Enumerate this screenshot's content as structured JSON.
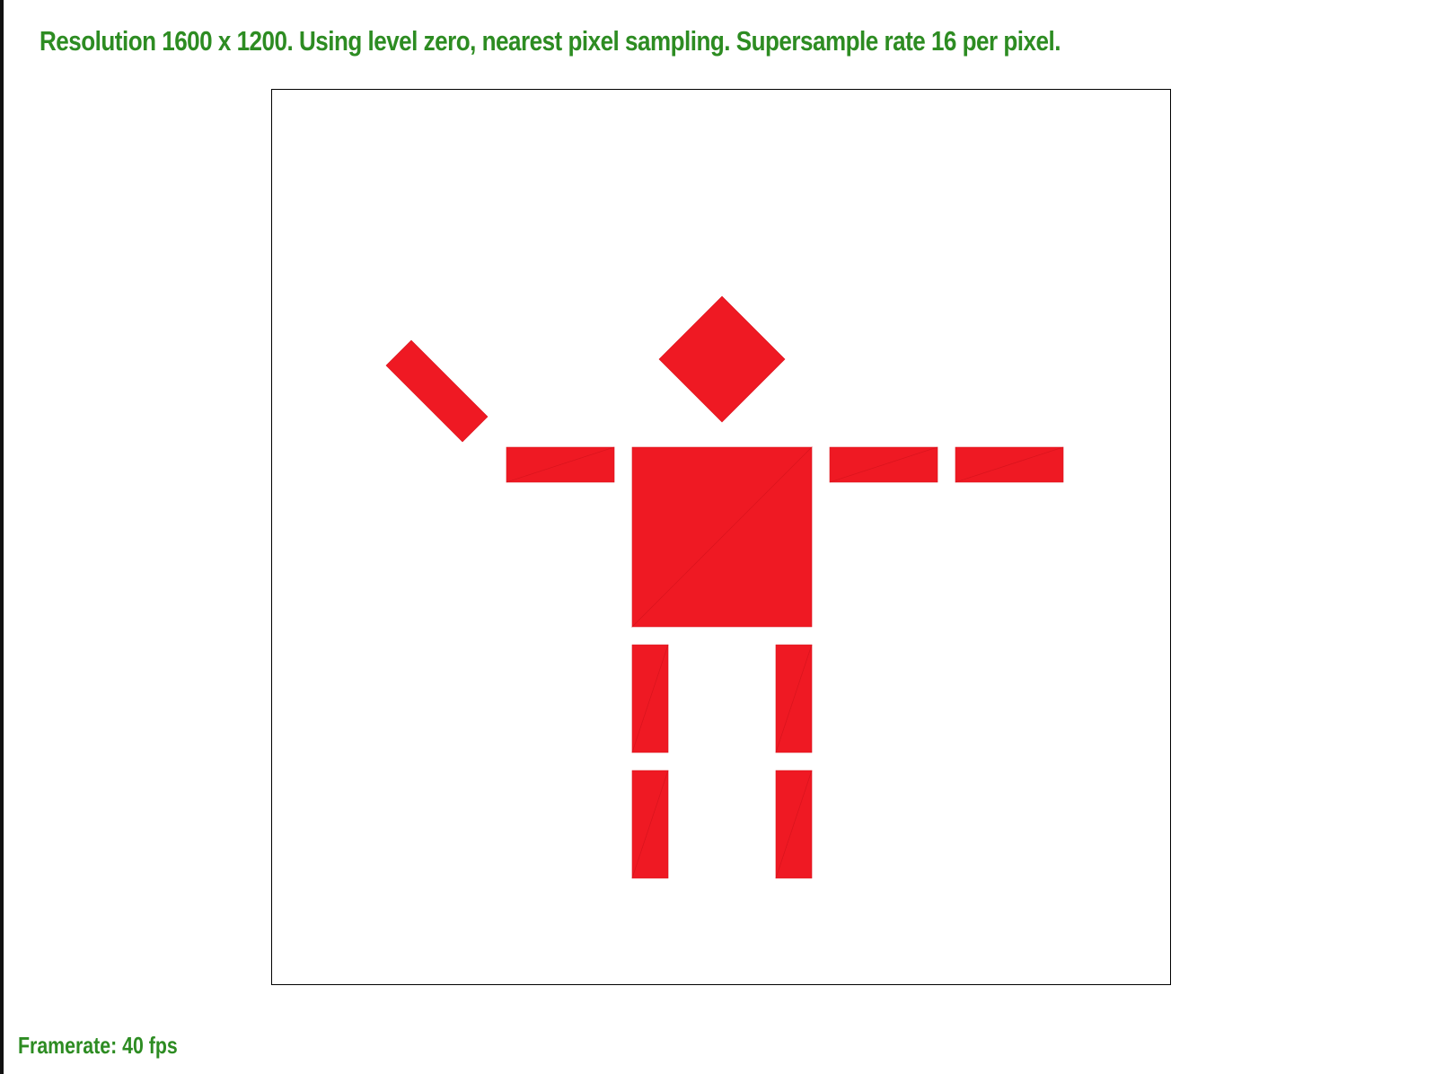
{
  "status": {
    "resolution_text": "Resolution 1600 x 1200. Using level zero, nearest pixel sampling. Supersample rate 16 per pixel.",
    "framerate_text": "Framerate: 40 fps"
  },
  "scene": {
    "fill_color": "#ef1923",
    "seam_color": "#d8141d",
    "text_color": "#2d8c22",
    "frame_color": "#000000",
    "background_color": "#ffffff"
  }
}
